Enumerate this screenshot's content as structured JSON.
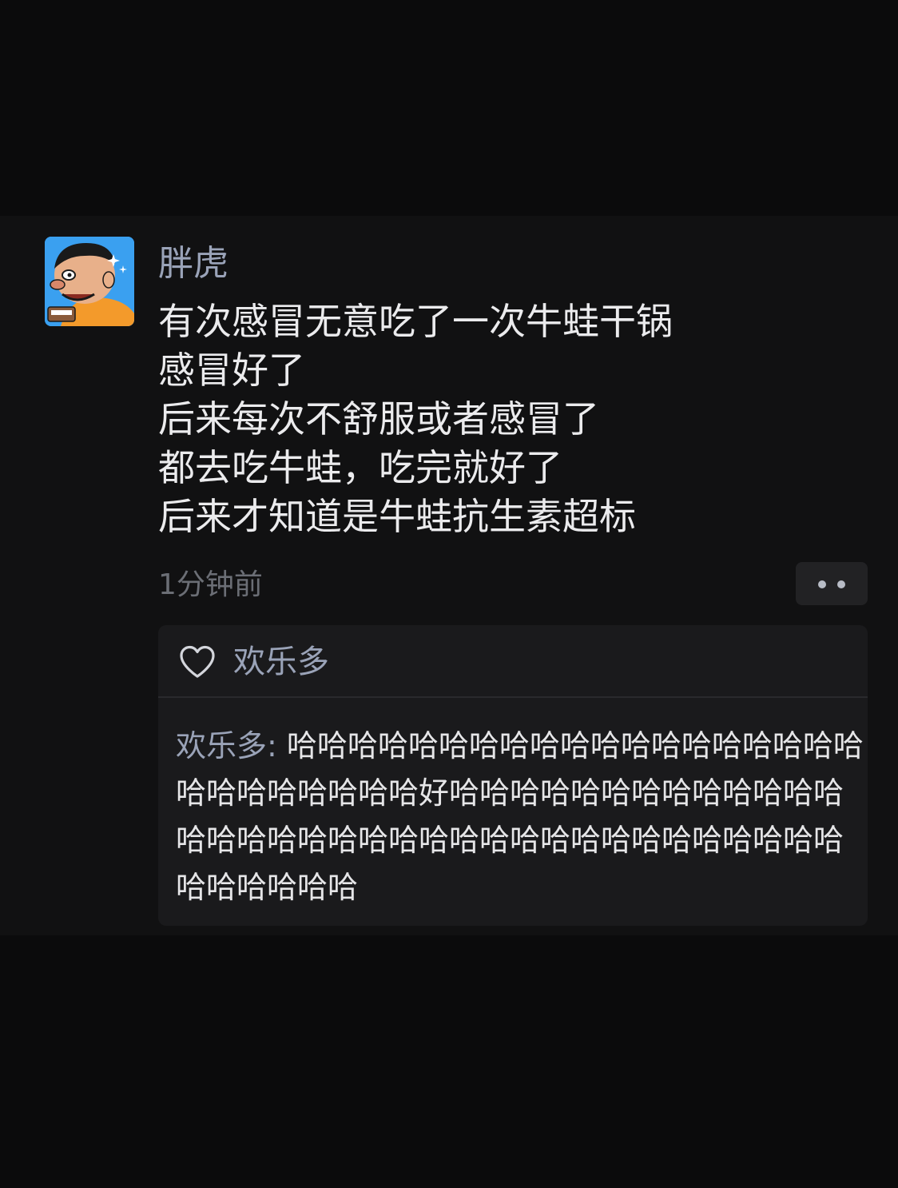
{
  "post": {
    "username": "胖虎",
    "avatar_icon": "cartoon-avatar-icon",
    "content_lines": [
      "有次感冒无意吃了一次牛蛙干锅",
      "感冒好了",
      "后来每次不舒服或者感冒了",
      "都去吃牛蛙，吃完就好了",
      "后来才知道是牛蛙抗生素超标"
    ],
    "timestamp": "1分钟前",
    "more_icon": "more-dots-icon"
  },
  "likes": {
    "icon": "heart-outline-icon",
    "names": "欢乐多"
  },
  "comments": [
    {
      "author": "欢乐多:",
      "text": "哈哈哈哈哈哈哈哈哈哈哈哈哈哈哈哈哈哈哈哈哈哈哈哈哈哈哈好哈哈哈哈哈哈哈哈哈哈哈哈哈哈哈哈哈哈哈哈哈哈哈哈哈哈哈哈哈哈哈哈哈哈哈哈哈哈哈哈哈"
    }
  ],
  "colors": {
    "background": "#0b0b0c",
    "card": "#111112",
    "panel": "#1a1a1c",
    "name_blue": "#9aa3b8",
    "text": "#ebebed",
    "muted": "#6b6e75"
  }
}
